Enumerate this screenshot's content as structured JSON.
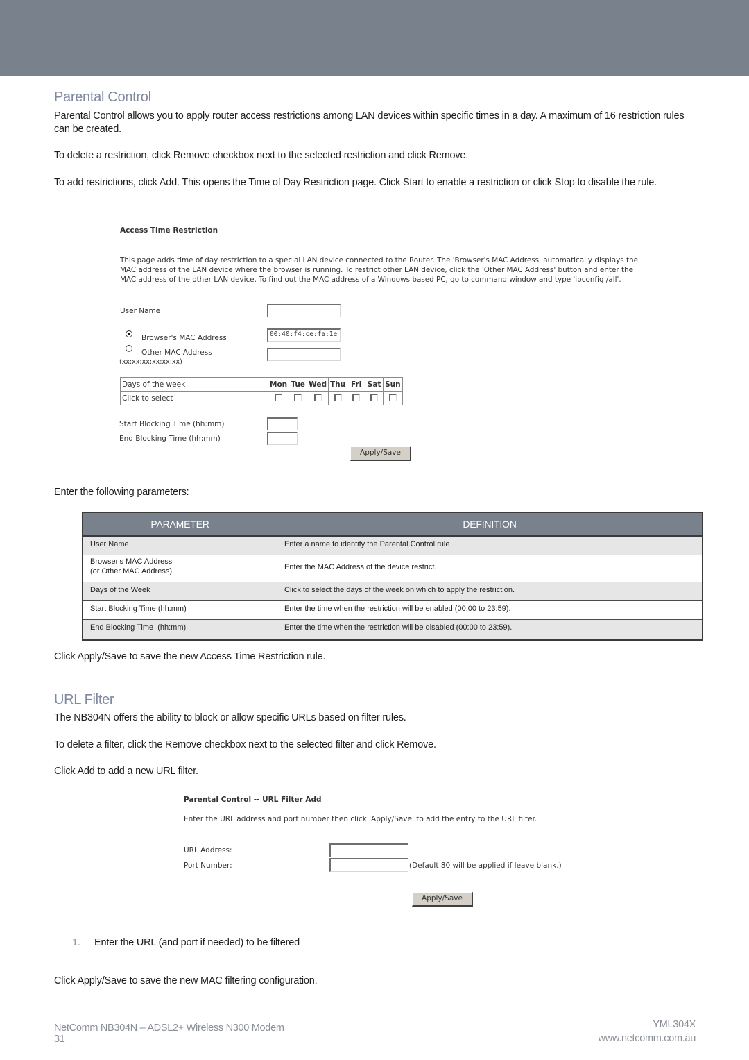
{
  "document": {
    "parental_control": {
      "heading": "Parental Control",
      "paragraphs": [
        "Parental Control allows you to apply router access restrictions among LAN devices within specific times in a day. A maximum of 16 restriction rules can be created.",
        "To delete a restriction, click Remove checkbox next to the selected restriction and click Remove.",
        "To add restrictions, click Add. This opens the Time of Day Restriction page. Click Start to enable a restriction or click Stop to disable the rule."
      ],
      "enter_params": "Enter the following parameters:",
      "after_table": "Click Apply/Save to save the new Access Time Restriction rule."
    },
    "url_filter": {
      "heading": "URL Filter",
      "paragraphs": [
        "The NB304N offers the ability to block or allow specific URLs based on filter rules.",
        "To delete a filter, click the Remove checkbox next to the selected filter and click Remove.",
        "Click Add to add a new URL filter."
      ],
      "steps": [
        {
          "number": "1.",
          "text": "Enter the URL (and port if needed) to be filtered"
        }
      ],
      "closing": "Click Apply/Save to save the new MAC filtering configuration."
    }
  },
  "access_time_screenshot": {
    "title": "Access Time Restriction",
    "description": "This page adds time of day restriction to a special LAN device connected to the Router. The 'Browser's MAC Address' automatically displays the MAC address of the LAN device where the browser is running. To restrict other LAN device, click the 'Other MAC Address' button and enter the MAC address of the other LAN device. To find out the MAC address of a Windows based PC, go to command window and type 'ipconfig /all'.",
    "user_name_label": "User Name",
    "user_name_value": "",
    "browser_mac_label": "Browser's MAC Address",
    "browser_mac_value": "00:40:f4:ce:fa:1e",
    "browser_mac_selected": true,
    "other_mac_label": "Other MAC Address",
    "other_mac_hint": "(xx:xx:xx:xx:xx:xx)",
    "other_mac_value": "",
    "days_label": "Days of the week",
    "click_to_select": "Click to select",
    "days": [
      "Mon",
      "Tue",
      "Wed",
      "Thu",
      "Fri",
      "Sat",
      "Sun"
    ],
    "start_label": "Start Blocking Time (hh:mm)",
    "end_label": "End Blocking Time (hh:mm)",
    "apply_label": "Apply/Save"
  },
  "parameter_table": {
    "headers": [
      "PARAMETER",
      "DEFINITION"
    ],
    "rows": [
      {
        "param": "User Name",
        "param2": "",
        "definition": "Enter a name to identify the Parental Control rule"
      },
      {
        "param": "Browser's MAC Address",
        "param2": "(or Other MAC Address)",
        "definition": "Enter the MAC Address of the device restrict."
      },
      {
        "param": "Days of the Week",
        "param2": "",
        "definition": "Click to select the days of the week on which to apply the restriction."
      },
      {
        "param": "Start Blocking Time (hh:mm)",
        "param2": "",
        "definition": "Enter the time when the restriction will be enabled (00:00 to 23:59)."
      },
      {
        "param": "End Blocking Time  (hh:mm)",
        "param2": "",
        "definition": "Enter the time when the restriction will be disabled (00:00 to 23:59)."
      }
    ]
  },
  "url_filter_screenshot": {
    "title": "Parental Control -- URL Filter Add",
    "description": "Enter the URL address and port number then click 'Apply/Save' to add the entry to the URL filter.",
    "url_label": "URL Address:",
    "url_value": "",
    "port_label": "Port Number:",
    "port_value": "",
    "port_hint": "(Default 80 will be applied if leave blank.)",
    "apply_label": "Apply/Save"
  },
  "footer": {
    "product": "NetComm NB304N – ADSL2+ Wireless N300 Modem",
    "page_number": "31",
    "doc_code": "YML304X",
    "website": "www.netcomm.com.au"
  },
  "colors": {
    "band": "#79828c",
    "heading": "#7f8aa0",
    "table_header": "#79828c"
  }
}
